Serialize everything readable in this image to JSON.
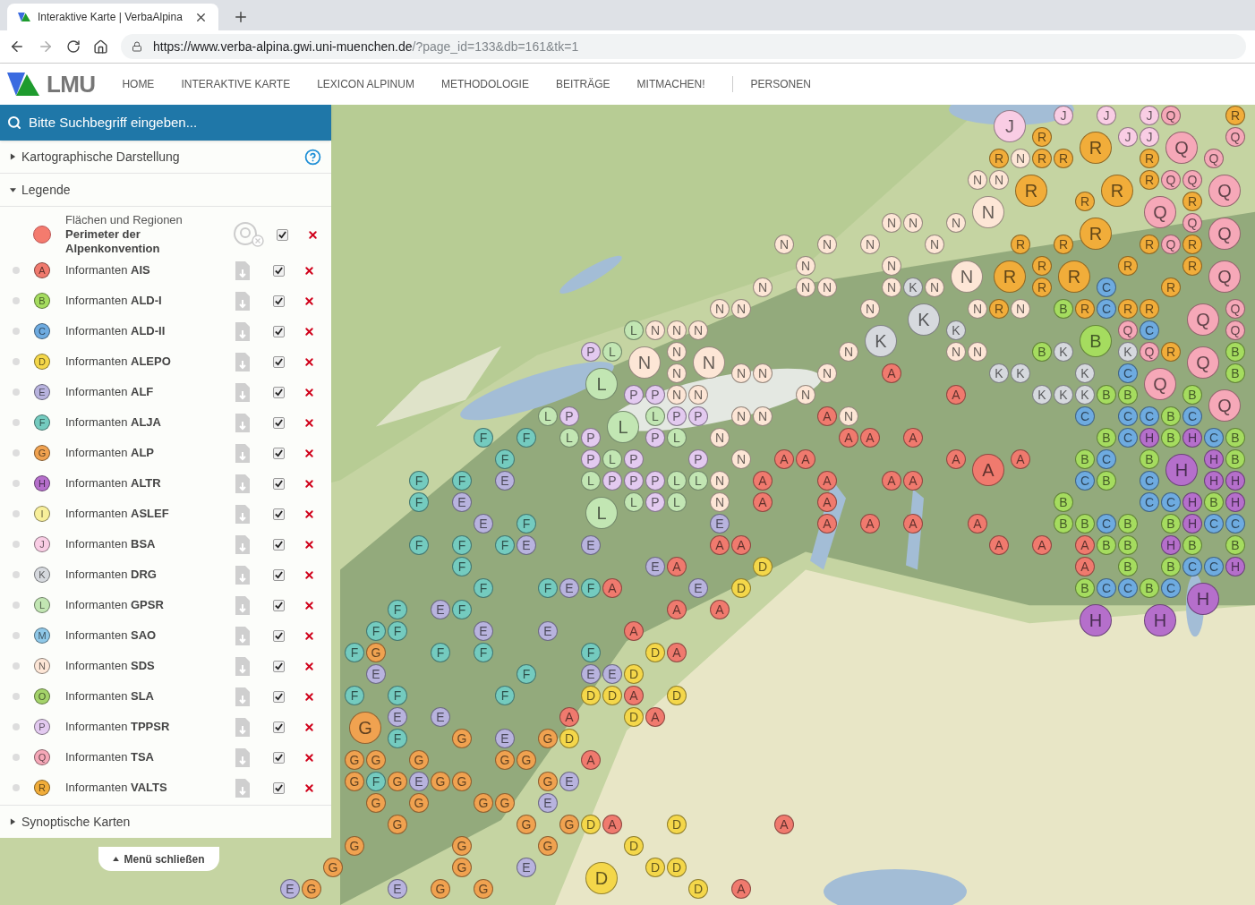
{
  "browser": {
    "tab": {
      "title": "Interaktive Karte | VerbaAlpina"
    },
    "url": {
      "host": "https://www.verba-alpina.gwi.uni-muenchen.de",
      "path": "/?page_id=133&db=161&tk=1"
    }
  },
  "site": {
    "logo_text": "LMU",
    "nav_items": [
      "HOME",
      "INTERAKTIVE KARTE",
      "LEXICON ALPINUM",
      "METHODOLOGIE",
      "BEITRÄGE",
      "MITMACHEN!"
    ],
    "nav_secondary_items": [
      "PERSONEN"
    ]
  },
  "sidebar": {
    "search": {
      "placeholder": "Bitte Suchbegriff eingeben..."
    },
    "sections": [
      {
        "title": "Kartographische Darstellung",
        "expanded": false,
        "help": true
      },
      {
        "title": "Legende",
        "expanded": true,
        "help": false
      }
    ],
    "legend": {
      "area_item": {
        "caption": "Flächen und Regionen",
        "title": "Perimeter der Alpenkonvention",
        "color": "#f47b6e",
        "checked": true
      },
      "items": [
        {
          "letter": "A",
          "label": "Informanten **AIS**",
          "color": "#f07a6e",
          "checked": true
        },
        {
          "letter": "B",
          "label": "Informanten **ALD-I**",
          "color": "#a5dc5f",
          "checked": true
        },
        {
          "letter": "C",
          "label": "Informanten **ALD-II**",
          "color": "#6eabe0",
          "checked": true
        },
        {
          "letter": "D",
          "label": "Informanten **ALEPO**",
          "color": "#f4d74a",
          "checked": true
        },
        {
          "letter": "E",
          "label": "Informanten **ALF**",
          "color": "#b8b3de",
          "checked": true
        },
        {
          "letter": "F",
          "label": "Informanten **ALJA**",
          "color": "#74cbbf",
          "checked": true
        },
        {
          "letter": "G",
          "label": "Informanten **ALP**",
          "color": "#f0a250",
          "checked": true
        },
        {
          "letter": "H",
          "label": "Informanten **ALTR**",
          "color": "#b56fcb",
          "checked": true
        },
        {
          "letter": "I",
          "label": "Informanten **ASLEF**",
          "color": "#f8ef9a",
          "checked": true
        },
        {
          "letter": "J",
          "label": "Informanten **BSA**",
          "color": "#f9cde4",
          "checked": true
        },
        {
          "letter": "K",
          "label": "Informanten **DRG**",
          "color": "#d6d9de",
          "checked": true
        },
        {
          "letter": "L",
          "label": "Informanten **GPSR**",
          "color": "#c2e6b3",
          "checked": true
        },
        {
          "letter": "M",
          "label": "Informanten **SAO**",
          "color": "#8fc8e8",
          "checked": true
        },
        {
          "letter": "N",
          "label": "Informanten **SDS**",
          "color": "#fde6d6",
          "checked": true
        },
        {
          "letter": "O",
          "label": "Informanten **SLA**",
          "color": "#a4d36a",
          "checked": true
        },
        {
          "letter": "P",
          "label": "Informanten **TPPSR**",
          "color": "#e3caf0",
          "checked": true
        },
        {
          "letter": "Q",
          "label": "Informanten **TSA**",
          "color": "#f6a8b8",
          "checked": true
        },
        {
          "letter": "R",
          "label": "Informanten **VALTS**",
          "color": "#f1ad3a",
          "checked": true
        }
      ]
    },
    "footer_section": {
      "title": "Synoptische Karten",
      "expanded": false
    },
    "close_button": "Menü schließen"
  },
  "map": {
    "layers": [
      {
        "color": "#f07a6e",
        "markers": [
          "A",
          "A",
          "A",
          "A",
          "A",
          "A",
          "A",
          "A",
          "A",
          "A",
          "A",
          "A",
          "A",
          "A",
          "A",
          "A",
          "A",
          "A",
          "A",
          "A",
          "A",
          "A",
          "A",
          "A",
          "A",
          "A",
          "A",
          "A",
          "A",
          "A",
          "A",
          "A",
          "A",
          "A",
          "A",
          "A",
          "A",
          "A",
          "A",
          "A"
        ]
      },
      {
        "color": "#f4d74a",
        "markers": [
          "D",
          "D",
          "D",
          "D",
          "D",
          "D",
          "D",
          "D",
          "D",
          "D",
          "D",
          "D",
          "D",
          "D",
          "D",
          "D"
        ]
      },
      {
        "color": "#f0a250",
        "markers": [
          "G",
          "G",
          "G",
          "G",
          "G",
          "G",
          "G",
          "G",
          "G",
          "G",
          "G",
          "G",
          "G",
          "G",
          "G",
          "G",
          "G",
          "G",
          "G",
          "G",
          "G",
          "G",
          "G",
          "G",
          "G",
          "G",
          "G",
          "G",
          "G"
        ]
      },
      {
        "color": "#b8b3de",
        "markers": [
          "E",
          "E",
          "E",
          "E",
          "E",
          "E",
          "E",
          "E",
          "E",
          "E",
          "E",
          "E",
          "E",
          "E",
          "E",
          "E",
          "E",
          "E",
          "E",
          "E",
          "E",
          "E",
          "E",
          "E"
        ]
      },
      {
        "color": "#74cbbf",
        "markers": [
          "F",
          "F",
          "F",
          "F",
          "F",
          "F",
          "F",
          "F",
          "F",
          "F",
          "F",
          "F",
          "F",
          "F",
          "F",
          "F",
          "F",
          "F",
          "F",
          "F",
          "F",
          "F",
          "F",
          "F",
          "F",
          "F",
          "F",
          "F"
        ]
      },
      {
        "color": "#c2e6b3",
        "markers": [
          "L",
          "L",
          "L",
          "L",
          "L",
          "L",
          "L",
          "L",
          "L",
          "L",
          "L",
          "L",
          "L",
          "L",
          "L"
        ]
      },
      {
        "color": "#e3caf0",
        "markers": [
          "P",
          "P",
          "P",
          "P",
          "P",
          "P",
          "P",
          "P",
          "P",
          "P",
          "P",
          "P",
          "P",
          "P",
          "P"
        ]
      },
      {
        "color": "#fde6d6",
        "markers": [
          "N",
          "N",
          "N",
          "N",
          "N",
          "N",
          "N",
          "N",
          "N",
          "N",
          "N",
          "N",
          "N",
          "N",
          "N",
          "N",
          "N",
          "N",
          "N",
          "N",
          "N",
          "N",
          "N",
          "N",
          "N",
          "N",
          "N",
          "N",
          "N",
          "N",
          "N",
          "N",
          "N",
          "N",
          "N",
          "N",
          "N",
          "N",
          "N",
          "N",
          "N",
          "N",
          "N",
          "N",
          "N",
          "N",
          "N"
        ]
      },
      {
        "color": "#d6d9de",
        "markers": [
          "K",
          "K",
          "K",
          "K",
          "K",
          "K",
          "K",
          "K",
          "K",
          "K",
          "K",
          "K"
        ]
      },
      {
        "color": "#f1ad3a",
        "markers": [
          "R",
          "R",
          "R",
          "R",
          "R",
          "R",
          "R",
          "R",
          "R",
          "R",
          "R",
          "R",
          "R",
          "R",
          "R",
          "R",
          "R",
          "R",
          "R",
          "R",
          "R",
          "R",
          "R",
          "R",
          "R",
          "R",
          "R",
          "R",
          "R"
        ]
      },
      {
        "color": "#f6a8b8",
        "markers": [
          "Q",
          "Q",
          "Q",
          "Q",
          "Q",
          "Q",
          "Q",
          "Q",
          "Q",
          "Q",
          "Q",
          "Q",
          "Q",
          "Q",
          "Q",
          "Q",
          "Q",
          "Q",
          "Q",
          "Q"
        ]
      },
      {
        "color": "#f9cde4",
        "markers": [
          "J",
          "J",
          "J",
          "J",
          "J",
          "J"
        ]
      },
      {
        "color": "#a5dc5f",
        "markers": [
          "B",
          "B",
          "B",
          "B",
          "B",
          "B",
          "B",
          "B",
          "B",
          "B",
          "B",
          "B",
          "B",
          "B",
          "B",
          "B",
          "B",
          "B",
          "B",
          "B",
          "B",
          "B",
          "B",
          "B",
          "B",
          "B",
          "B",
          "B",
          "B",
          "B"
        ]
      },
      {
        "color": "#6eabe0",
        "markers": [
          "C",
          "C",
          "C",
          "C",
          "C",
          "C",
          "C",
          "C",
          "C",
          "C",
          "C",
          "C",
          "C",
          "C",
          "C",
          "C",
          "C",
          "C",
          "C",
          "C",
          "C",
          "C",
          "C"
        ]
      },
      {
        "color": "#b56fcb",
        "markers": [
          "H",
          "H",
          "H",
          "H",
          "H",
          "H",
          "H",
          "H",
          "H",
          "H",
          "H",
          "H",
          "H",
          "H"
        ]
      }
    ]
  }
}
